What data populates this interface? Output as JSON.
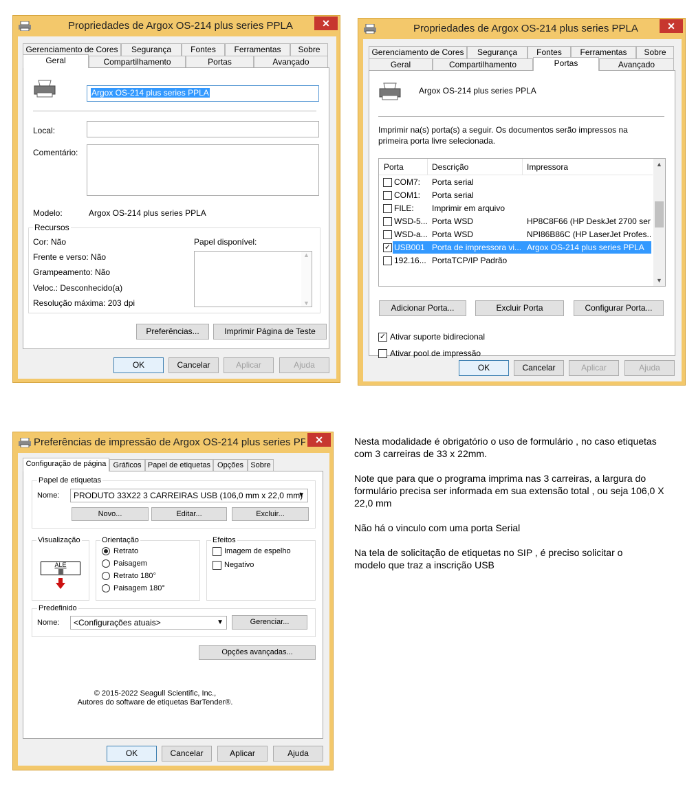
{
  "win1": {
    "title": "Propriedades de Argox OS-214 plus series PPLA",
    "close": "✕",
    "tabs_row1": [
      "Gerenciamento de Cores",
      "Segurança",
      "Fontes",
      "Ferramentas",
      "Sobre"
    ],
    "tabs_row2": [
      "Geral",
      "Compartilhamento",
      "Portas",
      "Avançado"
    ],
    "printer_name": "Argox OS-214 plus series PPLA",
    "local_label": "Local:",
    "comment_label": "Comentário:",
    "model_label": "Modelo:",
    "model_value": "Argox OS-214 plus series PPLA",
    "resources_label": "Recursos",
    "color": "Cor: Não",
    "duplex": "Frente e verso: Não",
    "staple": "Grampeamento: Não",
    "speed": "Veloc.: Desconhecido(a)",
    "resolution": "Resolução máxima: 203 dpi",
    "paper_label": "Papel disponível:",
    "prefs_button": "Preferências...",
    "test_button": "Imprimir Página de Teste",
    "ok": "OK",
    "cancel": "Cancelar",
    "apply": "Aplicar",
    "help": "Ajuda"
  },
  "win2": {
    "title": "Propriedades de Argox OS-214 plus series PPLA",
    "close": "✕",
    "tabs_row1": [
      "Gerenciamento de Cores",
      "Segurança",
      "Fontes",
      "Ferramentas",
      "Sobre"
    ],
    "tabs_row2": [
      "Geral",
      "Compartilhamento",
      "Portas",
      "Avançado"
    ],
    "printer_name": "Argox OS-214 plus series PPLA",
    "instruction": "Imprimir na(s) porta(s) a seguir. Os documentos serão impressos na primeira porta livre selecionada.",
    "columns": [
      "Porta",
      "Descrição",
      "Impressora"
    ],
    "ports": [
      {
        "port": "COM7:",
        "desc": "Porta serial",
        "printer": "",
        "checked": false,
        "selected": false
      },
      {
        "port": "COM1:",
        "desc": "Porta serial",
        "printer": "",
        "checked": false,
        "selected": false
      },
      {
        "port": "FILE:",
        "desc": "Imprimir em arquivo",
        "printer": "",
        "checked": false,
        "selected": false
      },
      {
        "port": "WSD-5...",
        "desc": "Porta WSD",
        "printer": "HP8C8F66 (HP DeskJet 2700 ser...",
        "checked": false,
        "selected": false
      },
      {
        "port": "WSD-a...",
        "desc": "Porta WSD",
        "printer": "NPI86B86C (HP LaserJet Profes...",
        "checked": false,
        "selected": false
      },
      {
        "port": "USB001",
        "desc": "Porta de impressora vi...",
        "printer": "Argox OS-214 plus series PPLA",
        "checked": true,
        "selected": true
      },
      {
        "port": "192.16...",
        "desc": "PortaTCP/IP Padrão",
        "printer": "",
        "checked": false,
        "selected": false
      }
    ],
    "add_port": "Adicionar Porta...",
    "delete_port": "Excluir Porta",
    "config_port": "Configurar Porta...",
    "bidi": "Ativar suporte bidirecional",
    "pool": "Ativar pool de impressão",
    "ok": "OK",
    "cancel": "Cancelar",
    "apply": "Aplicar",
    "help": "Ajuda"
  },
  "win3": {
    "title": "Preferências de impressão de Argox OS-214 plus series PP...",
    "close": "✕",
    "tabs": [
      "Configuração de página",
      "Gráficos",
      "Papel de etiquetas",
      "Opções",
      "Sobre"
    ],
    "stock_group": "Papel de etiquetas",
    "name_label": "Nome:",
    "stock_value": "PRODUTO 33X22 3 CARREIRAS USB (106,0 mm x 22,0 mm)",
    "new": "Novo...",
    "edit": "Editar...",
    "delete": "Excluir...",
    "preview_group": "Visualização",
    "preview_text": "ALE",
    "orientation_group": "Orientação",
    "orientations": [
      "Retrato",
      "Paisagem",
      "Retrato 180°",
      "Paisagem 180°"
    ],
    "effects_group": "Efeitos",
    "mirror": "Imagem de espelho",
    "negative": "Negativo",
    "preset_group": "Predefinido",
    "preset_label": "Nome:",
    "preset_value": "<Configurações atuais>",
    "manage": "Gerenciar...",
    "advanced": "Opções avançadas...",
    "copyright1": "© 2015-2022 Seagull Scientific, Inc.,",
    "copyright2": "Autores do software de etiquetas BarTender®.",
    "ok": "OK",
    "cancel": "Cancelar",
    "apply": "Aplicar",
    "help": "Ajuda"
  },
  "notes": {
    "p1": "Nesta modalidade é obrigatório o uso de formulário , no caso etiquetas com 3 carreiras de 33 x 22mm.",
    "p2": "Note que para que o programa imprima nas 3 carreiras, a largura do formulário precisa ser informada em sua extensão total , ou seja 106,0 X 22,0 mm",
    "p3": "Não há o vinculo com uma porta Serial",
    "p4": "Na tela de solicitação de etiquetas no SIP , é preciso solicitar o modelo que traz a inscrição USB"
  },
  "colors": {
    "frame": "#f3c86b",
    "close": "#c7372f",
    "selection": "#3399ff",
    "arrow": "#cc1111"
  }
}
